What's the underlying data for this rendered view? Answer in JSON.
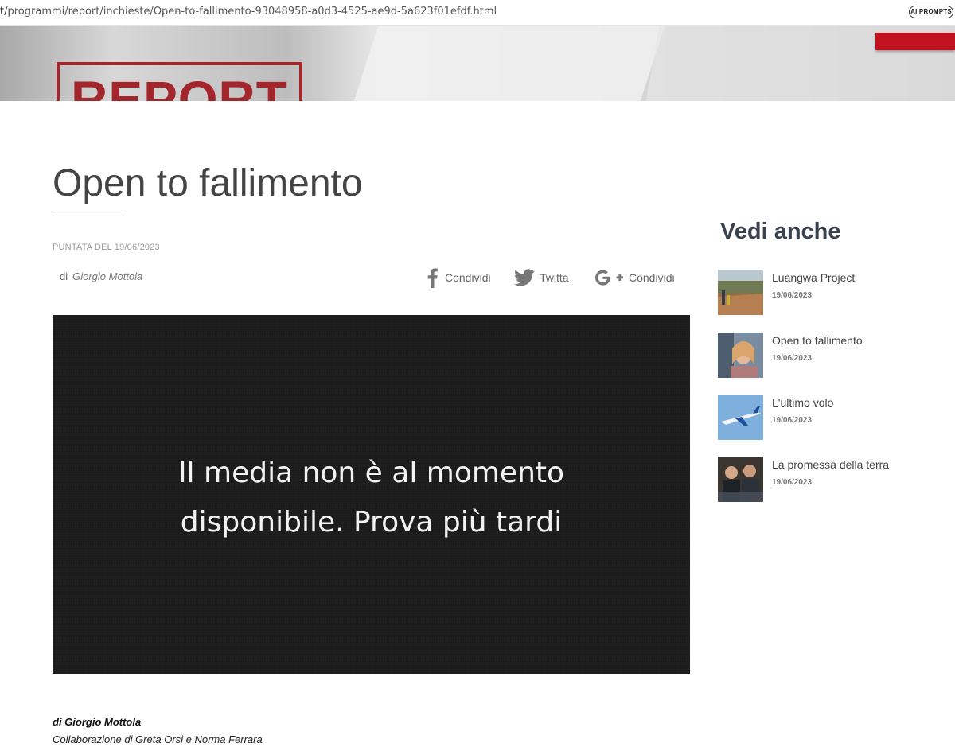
{
  "browser": {
    "url_prefix": "t",
    "url_rest": "/programmi/report/inchieste/Open-to-fallimento-93048958-a0d3-4525-ae9d-5a623f01efdf.html",
    "ai_button": "AI PROMPTS"
  },
  "header": {
    "logo": "REPORT"
  },
  "article": {
    "title": "Open to fallimento",
    "episode": "PUNTATA DEL 19/06/2023",
    "by_prefix": "di",
    "author": "Giorgio Mottola",
    "player_message_line1": "Il media non è al momento",
    "player_message_line2": "disponibile. Prova più tardi",
    "credit_author": "di Giorgio Mottola",
    "credit_collab": "Collaborazione di Greta Orsi e Norma Ferrara"
  },
  "share": {
    "facebook": "Condividi",
    "twitter": "Twitta",
    "googleplus": "Condividi"
  },
  "sidebar": {
    "title": "Vedi anche",
    "items": [
      {
        "label": "Luangwa Project",
        "date": "19/06/2023"
      },
      {
        "label": "Open to fallimento",
        "date": "19/06/2023"
      },
      {
        "label": "L'ultimo volo",
        "date": "19/06/2023"
      },
      {
        "label": "La promessa della terra",
        "date": "19/06/2023"
      }
    ]
  }
}
